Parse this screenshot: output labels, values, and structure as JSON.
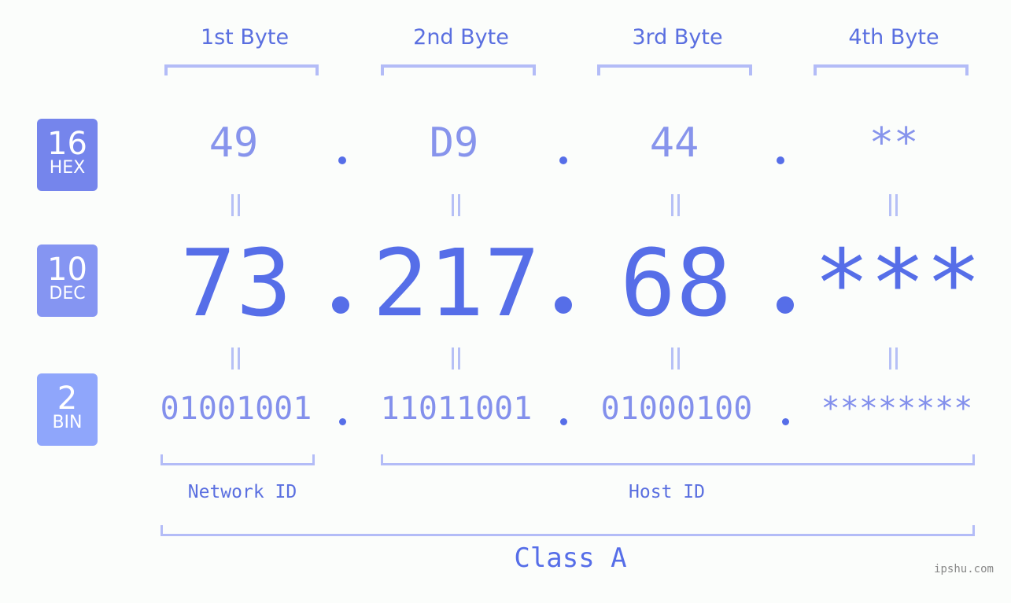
{
  "bytes": [
    {
      "label": "1st Byte",
      "hex": "49",
      "dec": "73",
      "bin": "01001001"
    },
    {
      "label": "2nd Byte",
      "hex": "D9",
      "dec": "217",
      "bin": "11011001"
    },
    {
      "label": "3rd Byte",
      "hex": "44",
      "dec": "68",
      "bin": "01000100"
    },
    {
      "label": "4th Byte",
      "hex": "**",
      "dec": "***",
      "bin": "********"
    }
  ],
  "badges": {
    "hex": {
      "num": "16",
      "label": "HEX",
      "color": "#7585ec"
    },
    "dec": {
      "num": "10",
      "label": "DEC",
      "color": "#8595f2"
    },
    "bin": {
      "num": "2",
      "label": "BIN",
      "color": "#8fa6fb"
    }
  },
  "network_id_label": "Network ID",
  "host_id_label": "Host ID",
  "class_label": "Class A",
  "watermark": "ipshu.com",
  "colors": {
    "accent": "#566ee8",
    "bracket": "#b3bcf7",
    "hex_text": "#8794ec",
    "background": "#fbfdfb"
  }
}
